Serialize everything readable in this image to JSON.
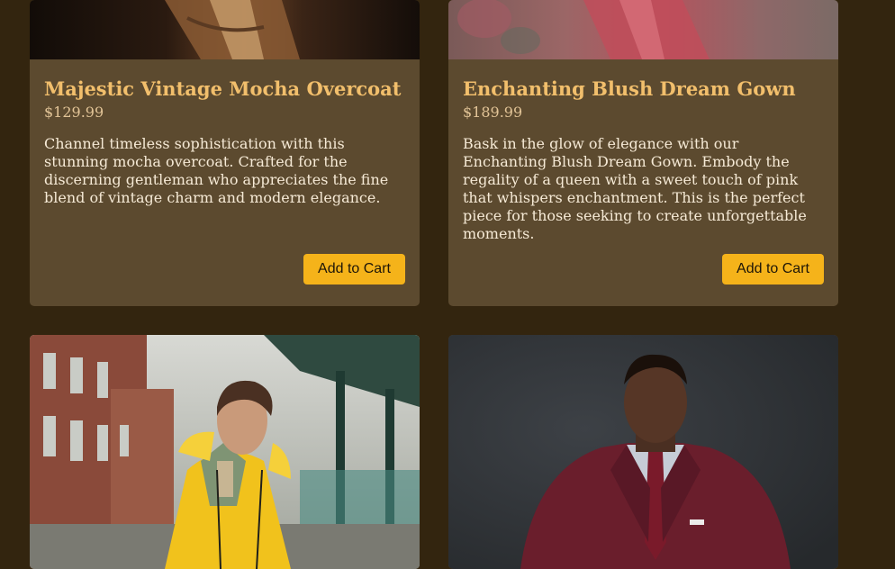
{
  "products": [
    {
      "name": "Majestic Vintage Mocha Overcoat",
      "price": "$129.99",
      "description": "Channel timeless sophistication with this stunning mocha overcoat. Crafted for the discerning gentleman who appreciates the fine blend of vintage charm and modern elegance.",
      "button_label": "Add to Cart"
    },
    {
      "name": "Enchanting Blush Dream Gown",
      "price": "$189.99",
      "description": "Bask in the glow of elegance with our Enchanting Blush Dream Gown. Embody the regality of a queen with a sweet touch of pink that whispers enchantment. This is the perfect piece for those seeking to create unforgettable moments.",
      "button_label": "Add to Cart"
    },
    {
      "name": "",
      "price": "",
      "description": "",
      "button_label": ""
    },
    {
      "name": "",
      "price": "",
      "description": "",
      "button_label": ""
    }
  ],
  "colors": {
    "page_background": "#33250f",
    "card_background": "#5c4a2f",
    "title": "#f2bf6c",
    "button": "#f5b31a"
  }
}
